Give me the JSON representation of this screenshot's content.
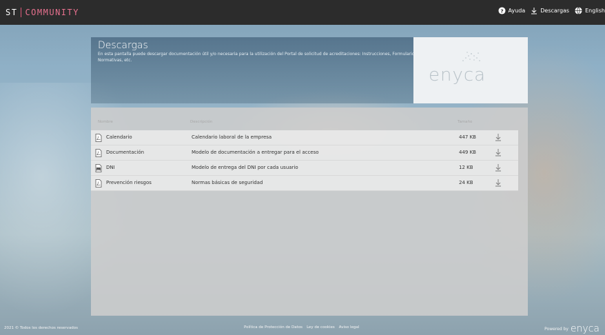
{
  "app": {
    "logo_left": "ST",
    "logo_right": "COMMUNITY"
  },
  "topnav": {
    "help": "Ayuda",
    "downloads": "Descargas",
    "language": "English"
  },
  "header": {
    "title": "Descargas",
    "description": "En esta pantalla puede descargar documentación útil y/o necesaria para la utilización del Portal de solicitud de acreditaciones: Instrucciones, Formularios, Normativas, etc.",
    "brand": "enyca"
  },
  "table": {
    "columns": [
      "Nombre",
      "Descripción",
      "Tamaño"
    ],
    "rows": [
      {
        "name": "Calendario",
        "description": "Calendario laboral de la empresa",
        "size": "447 KB",
        "icon": "pdf-file-icon"
      },
      {
        "name": "Documentación",
        "description": "Modelo de documentación a entregar para el acceso",
        "size": "449 KB",
        "icon": "pdf-file-icon"
      },
      {
        "name": "DNI",
        "description": "Modelo de entrega del DNI por cada usuario",
        "size": "12 KB",
        "icon": "image-file-icon"
      },
      {
        "name": "Prevención riesgos",
        "description": "Normas básicas de seguridad",
        "size": "24 KB",
        "icon": "pdf-file-icon"
      }
    ]
  },
  "footer": {
    "copyright": "2021 © Todos los derechos reservados",
    "links": [
      "Política de Protección de Datos",
      "Ley de cookies",
      "Aviso legal"
    ],
    "powered_by": "Powered by",
    "powered_brand": "enyca"
  },
  "colors": {
    "topbar": "#2c2c2c",
    "accent": "#e8718f"
  }
}
